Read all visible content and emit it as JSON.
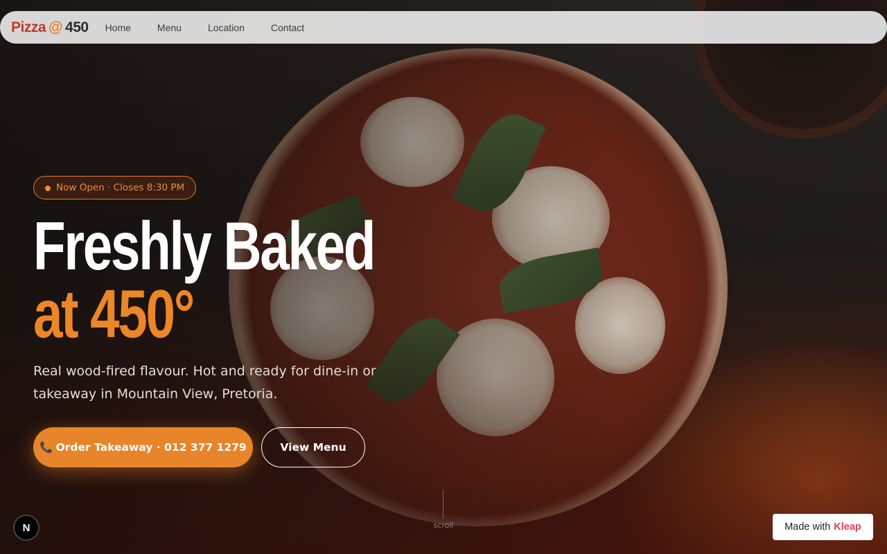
{
  "nav": {
    "logo": {
      "part1": "Pizza",
      "part2": "@",
      "part3": "450"
    },
    "links": [
      "Home",
      "Menu",
      "Location",
      "Contact"
    ]
  },
  "hero": {
    "badge": "Now Open · Closes 8:30 PM",
    "title_line1": "Freshly Baked",
    "title_line2": "at 450°",
    "subtitle": "Real wood-fired flavour. Hot and ready for dine-in or takeaway in Mountain View, Pretoria.",
    "primary_button": {
      "icon": "📞",
      "label": "Order Takeaway · 012 377 1279"
    },
    "secondary_button": "View Menu",
    "scroll_label": "scroll"
  },
  "footer_widgets": {
    "next_badge": "N",
    "made_with_prefix": "Made with",
    "made_with_brand": "Kleap"
  },
  "colors": {
    "accent": "#e8842a",
    "logo_red": "#c0392b",
    "brand_pink": "#e83a5c"
  }
}
